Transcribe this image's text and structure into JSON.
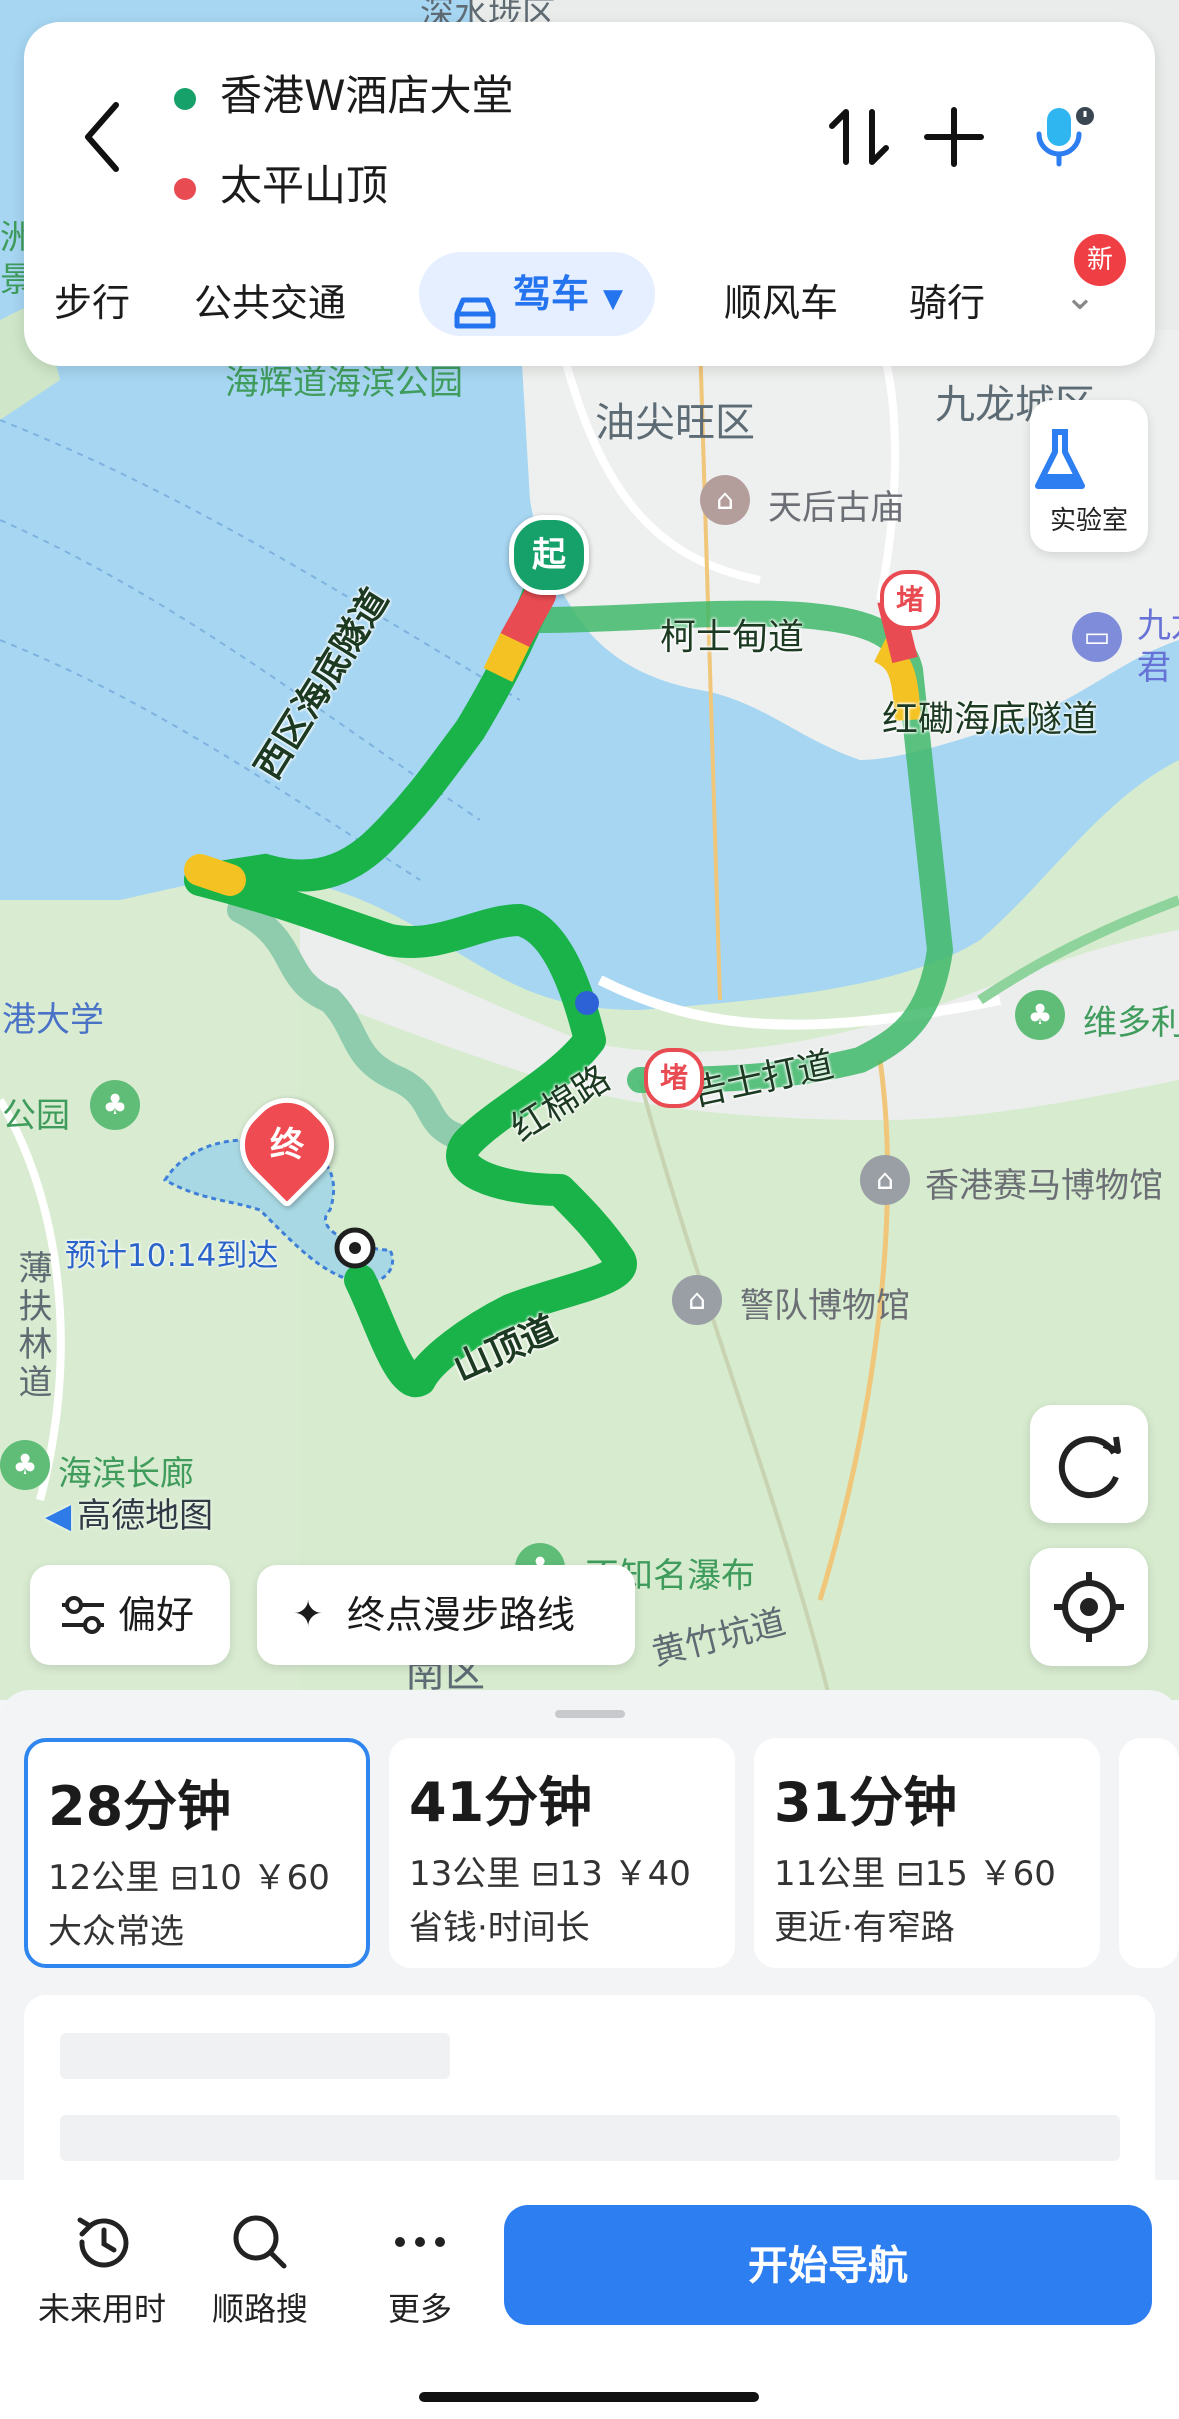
{
  "route": {
    "origin": "香港W酒店大堂",
    "destination": "太平山顶"
  },
  "modes": [
    {
      "label": "步行"
    },
    {
      "label": "公共交通"
    },
    {
      "label": "驾车",
      "active": true
    },
    {
      "label": "顺风车"
    },
    {
      "label": "骑行"
    }
  ],
  "new_badge": "新",
  "lab_label": "实验室",
  "map": {
    "labels": {
      "yau_tsim_mong": "油尖旺区",
      "kowloon_city": "九龙城区",
      "tin_hau_temple": "天后古庙",
      "kowloon_right": "九龙",
      "kowloon_right2": "君",
      "harbour_park": "海辉道海滨公园",
      "shenzhen": "深水埗区",
      "hk_university": "港大学",
      "park_left": "公园",
      "victoria": "维多利",
      "racing_museum": "香港赛马博物馆",
      "police_museum": "警队博物馆",
      "waterfront": "海滨长廊",
      "waterfall": "不知名瀑布",
      "wong_chuk_hang_rd": "黄竹坑道",
      "south": "南区",
      "pok_fu_lam": "薄扶林道",
      "left_edge_1": "洲",
      "left_edge_2": "景"
    },
    "roads": {
      "tunnel_west": "西区海底隧道",
      "canton_rd": "柯士甸道",
      "cross_tunnel": "红磡海底隧道",
      "cotton_tree": "红棉路",
      "gloucester": "告士打道",
      "peak_rd": "山顶道"
    },
    "start_marker": "起",
    "end_marker": "终",
    "jam_marker": "堵",
    "eta": "预计10:14到达",
    "logo": "高德地图"
  },
  "map_buttons": {
    "preference": "偏好",
    "walk_route": "终点漫步路线"
  },
  "routes": [
    {
      "time": "28分钟",
      "distance": "12公里",
      "lights": "10",
      "cost": "￥60",
      "tag": "大众常选",
      "selected": true
    },
    {
      "time": "41分钟",
      "distance": "13公里",
      "lights": "13",
      "cost": "￥40",
      "tag": "省钱·时间长"
    },
    {
      "time": "31分钟",
      "distance": "11公里",
      "lights": "15",
      "cost": "￥60",
      "tag": "更近·有窄路"
    }
  ],
  "bottom_bar": {
    "future": "未来用时",
    "along_search": "顺路搜",
    "more": "更多",
    "start_nav": "开始导航"
  },
  "colors": {
    "accent": "#2d7ef0",
    "route_green": "#19b34a",
    "jam_red": "#e94b52",
    "start_green": "#16a06a"
  }
}
